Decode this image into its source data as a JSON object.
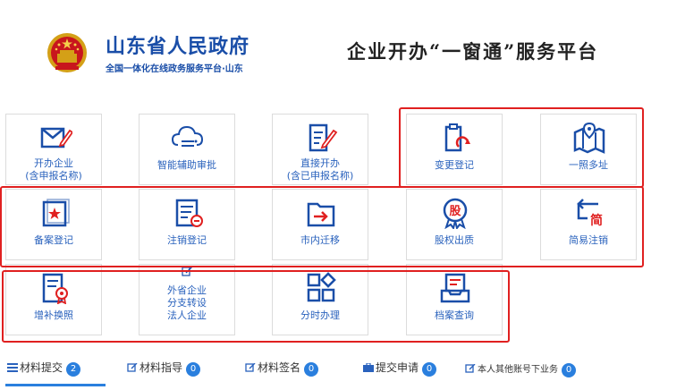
{
  "header": {
    "gov_title": "山东省人民政府",
    "gov_subtitle": "全国一体化在线政务服务平台·山东",
    "platform_title": "企业开办“一窗通”服务平台"
  },
  "tiles": [
    {
      "lines": [
        "开办企业",
        "(含申报名称)"
      ]
    },
    {
      "lines": [
        "智能辅助审批"
      ]
    },
    {
      "lines": [
        "直接开办",
        "(含已申报名称)"
      ]
    },
    {
      "lines": [
        "变更登记"
      ]
    },
    {
      "lines": [
        "一照多址"
      ]
    },
    {
      "lines": [
        "备案登记"
      ]
    },
    {
      "lines": [
        "注销登记"
      ]
    },
    {
      "lines": [
        "市内迁移"
      ]
    },
    {
      "lines": [
        "股权出质"
      ]
    },
    {
      "lines": [
        "简易注销"
      ]
    },
    {
      "lines": [
        "增补换照"
      ]
    },
    {
      "lines": [
        "外省企业",
        "分支转设",
        "法人企业"
      ]
    },
    {
      "lines": [
        "分时办理"
      ]
    },
    {
      "lines": [
        "档案查询"
      ]
    }
  ],
  "icon_glyphs": {
    "equity": "股",
    "simple": "简"
  },
  "tabs": [
    {
      "label": "材料提交",
      "count": "2"
    },
    {
      "label": "材料指导",
      "count": "0"
    },
    {
      "label": "材料签名",
      "count": "0"
    },
    {
      "label": "提交申请",
      "count": "0"
    },
    {
      "label": "本人其他账号下业务",
      "count": "0"
    }
  ],
  "colors": {
    "brand_blue": "#1a4ea8",
    "icon_blue": "#2a62bd",
    "accent_red": "#e02020",
    "badge_blue": "#2a7fde"
  }
}
